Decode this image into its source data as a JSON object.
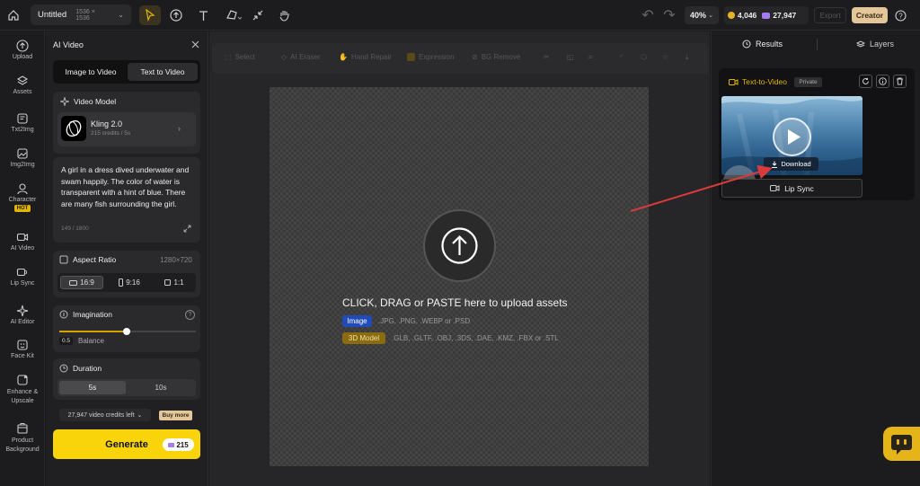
{
  "topbar": {
    "title": "Untitled",
    "size": "1536 × 1536",
    "zoom": "40%",
    "coins": "4,046",
    "gems": "27,947",
    "export": "Export",
    "creator": "Creator"
  },
  "leftnav": {
    "items": [
      {
        "label": "Upload"
      },
      {
        "label": "Assets"
      },
      {
        "label": "Txt2Img"
      },
      {
        "label": "Img2Img"
      },
      {
        "label": "Character"
      },
      {
        "label": "AI Video"
      },
      {
        "label": "Lip Sync"
      },
      {
        "label": "AI Editor"
      },
      {
        "label": "Face Kit"
      },
      {
        "label": "Enhance & Upscale"
      },
      {
        "label": "Product Background"
      }
    ],
    "hot": "HOT"
  },
  "panel": {
    "title": "AI Video",
    "tabs": [
      "Image to Video",
      "Text to Video"
    ],
    "model_heading": "Video Model",
    "model_name": "Kling 2.0",
    "model_sub": "215 credits / 5s",
    "prompt": "A girl in a dress dived underwater and swam happily. The color of water is transparent with a hint of blue. There are many fish surrounding the girl.",
    "prompt_count": "149 / 1800",
    "aspect_heading": "Aspect Ratio",
    "aspect_res": "1280×720",
    "aspects": [
      "16:9",
      "9:16",
      "1:1"
    ],
    "imagination_heading": "Imagination",
    "imagination_value": "0.5",
    "imagination_label": "Balance",
    "duration_heading": "Duration",
    "durations": [
      "5s",
      "10s"
    ],
    "credits_left": "27,947 video credits left",
    "buy_more": "Buy more",
    "generate": "Generate",
    "generate_cost": "215"
  },
  "canvas": {
    "tools": [
      "Select",
      "AI Eraser",
      "Hand Repair",
      "Expression",
      "BG Remove"
    ],
    "upload_title": "CLICK, DRAG or PASTE here to upload assets",
    "image_badge": "Image",
    "image_formats": ".JPG, .PNG, .WEBP or .PSD",
    "model_badge": "3D Model",
    "model_formats": ".GLB, .GLTF, .OBJ, .3DS, .DAE, .KMZ, .FBX or .STL"
  },
  "right": {
    "results": "Results",
    "layers": "Layers",
    "card_title": "Text-to-Video",
    "private": "Private",
    "download": "Download",
    "lip_sync": "Lip Sync"
  },
  "colors": {
    "accent": "#fad40a",
    "arrow": "#d93a3a"
  }
}
